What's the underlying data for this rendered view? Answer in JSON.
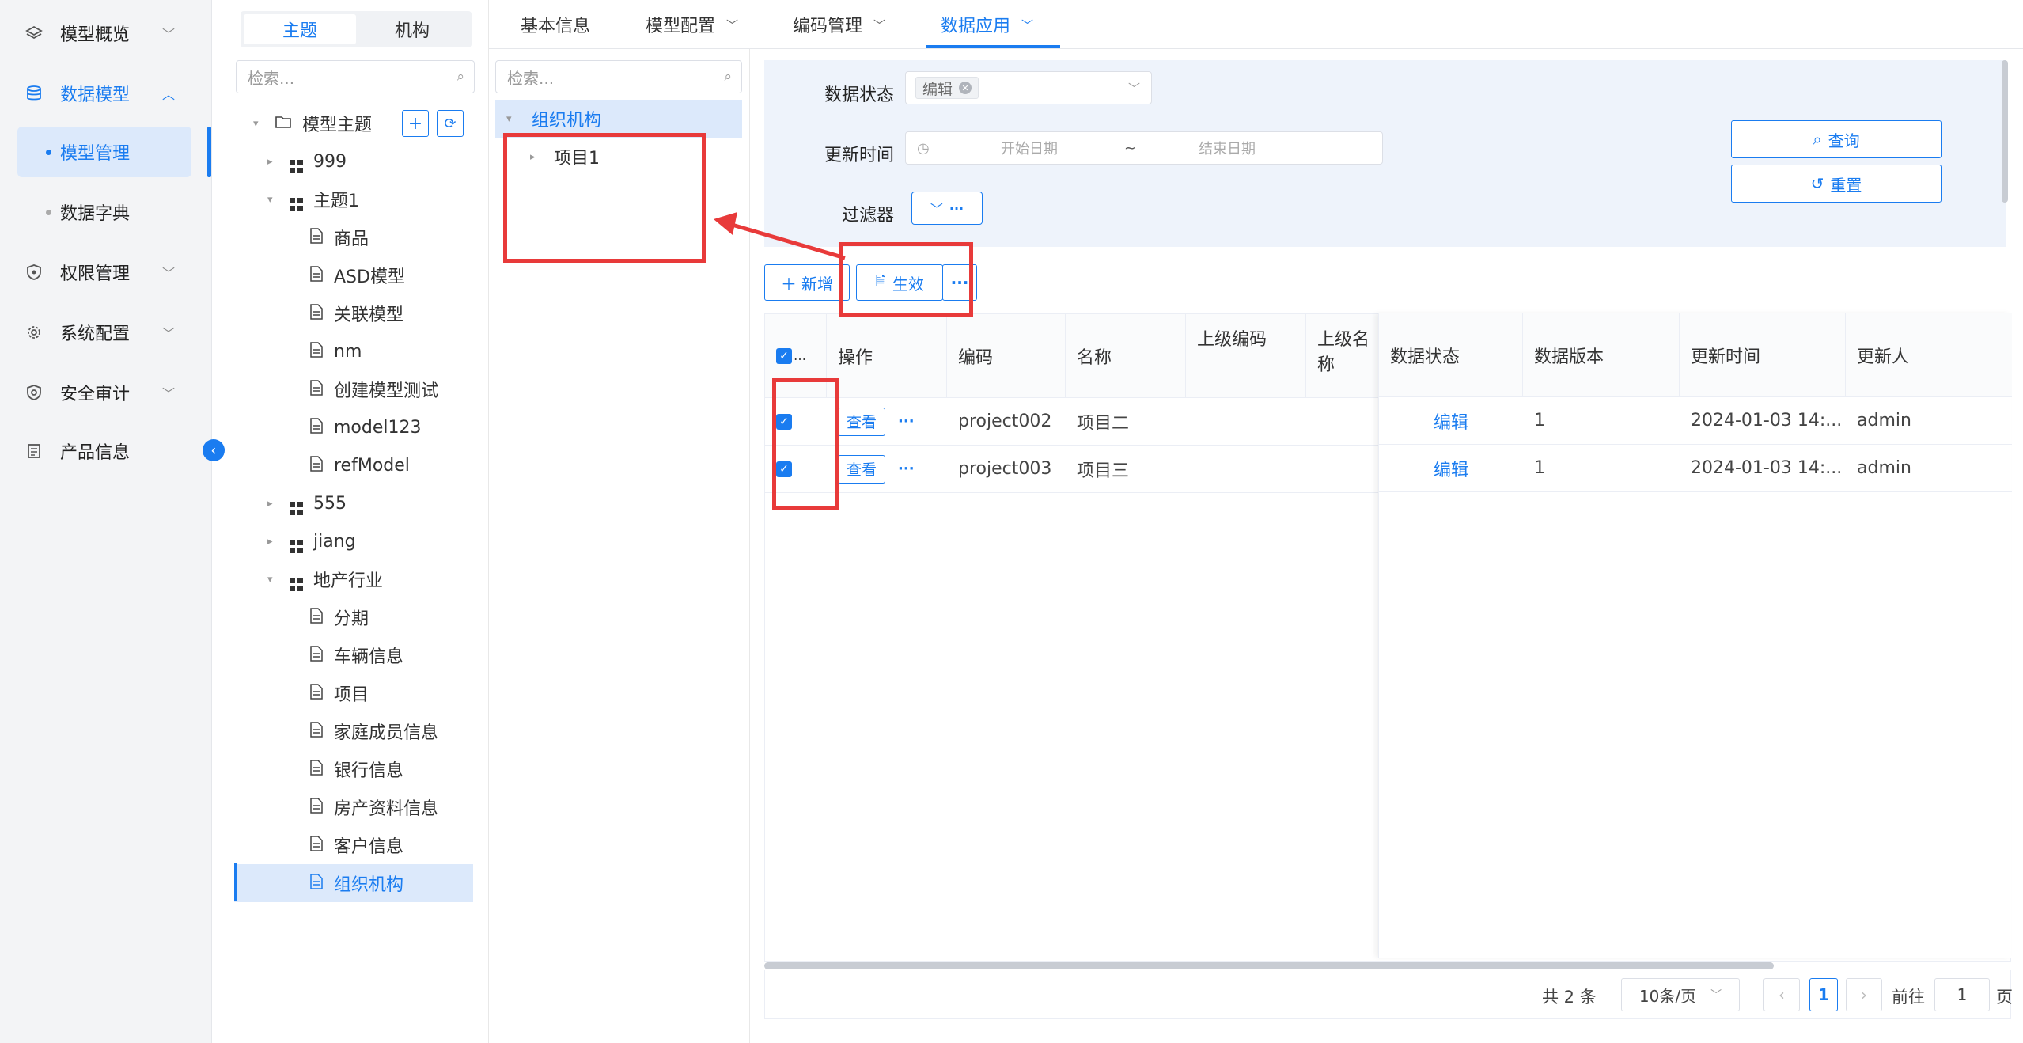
{
  "nav": {
    "items": [
      {
        "label": "模型概览",
        "icon": "layers-icon"
      },
      {
        "label": "数据模型",
        "icon": "database-icon"
      },
      {
        "label": "权限管理",
        "icon": "shield-icon"
      },
      {
        "label": "系统配置",
        "icon": "gear-icon"
      },
      {
        "label": "安全审计",
        "icon": "shield-check-icon"
      },
      {
        "label": "产品信息",
        "icon": "document-icon"
      }
    ],
    "sub": [
      {
        "label": "模型管理",
        "active": true
      },
      {
        "label": "数据字典",
        "active": false
      }
    ]
  },
  "tree_panel": {
    "segments": [
      "主题",
      "机构"
    ],
    "search_placeholder": "检索...",
    "root": "模型主题",
    "rows": [
      {
        "label": "999",
        "type": "group"
      },
      {
        "label": "主题1",
        "type": "group"
      },
      {
        "label": "商品",
        "type": "doc"
      },
      {
        "label": "ASD模型",
        "type": "doc"
      },
      {
        "label": "关联模型",
        "type": "doc"
      },
      {
        "label": "nm",
        "type": "doc"
      },
      {
        "label": "创建模型测试",
        "type": "doc"
      },
      {
        "label": "model123",
        "type": "doc"
      },
      {
        "label": "refModel",
        "type": "doc"
      },
      {
        "label": "555",
        "type": "group"
      },
      {
        "label": "jiang",
        "type": "group"
      },
      {
        "label": "地产行业",
        "type": "group"
      },
      {
        "label": "分期",
        "type": "doc"
      },
      {
        "label": "车辆信息",
        "type": "doc"
      },
      {
        "label": "项目",
        "type": "doc"
      },
      {
        "label": "家庭成员信息",
        "type": "doc"
      },
      {
        "label": "银行信息",
        "type": "doc"
      },
      {
        "label": "房产资料信息",
        "type": "doc"
      },
      {
        "label": "客户信息",
        "type": "doc"
      },
      {
        "label": "组织机构",
        "type": "doc"
      }
    ]
  },
  "tabs": [
    "基本信息",
    "模型配置",
    "编码管理",
    "数据应用"
  ],
  "org_panel": {
    "search_placeholder": "检索...",
    "root": "组织机构",
    "child": "项目1"
  },
  "filter": {
    "status_label": "数据状态",
    "status_tag": "编辑",
    "time_label": "更新时间",
    "start_placeholder": "开始日期",
    "tilde": "~",
    "end_placeholder": "结束日期",
    "filter_label": "过滤器",
    "query": "查询",
    "reset": "重置"
  },
  "toolbar": {
    "add": "新增",
    "activate": "生效"
  },
  "table": {
    "headers": [
      "操作",
      "编码",
      "名称",
      "上级编码",
      "上级名称",
      "数据状态",
      "数据版本",
      "更新时间",
      "更新人"
    ],
    "view_label": "查看",
    "rows": [
      {
        "code": "project002",
        "name": "项目二",
        "status": "编辑",
        "version": "1",
        "time": "2024-01-03 14:...",
        "user": "admin"
      },
      {
        "code": "project003",
        "name": "项目三",
        "status": "编辑",
        "version": "1",
        "time": "2024-01-03 14:...",
        "user": "admin"
      }
    ]
  },
  "pager": {
    "total": "共 2 条",
    "page_size": "10条/页",
    "current": "1",
    "goto": "前往",
    "goto_value": "1",
    "page_unit": "页"
  },
  "colors": {
    "primary": "#1a7cf0",
    "annotation": "#e83a3a",
    "filter_bg": "#eef3fb"
  }
}
